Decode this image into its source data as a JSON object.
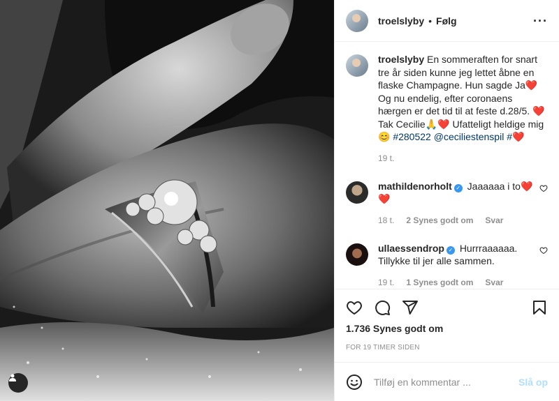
{
  "post": {
    "author": "troelslyby",
    "follow_label": "Følg",
    "dot": "•",
    "more_label": "···",
    "caption": {
      "user": "troelslyby",
      "text_1": "En sommeraften for snart tre år siden kunne jeg lettet åbne en flaske Champagne. Hun sagde Ja",
      "heart": "❤️",
      "text_2": "Og nu endelig, efter coronaens hærgen er det tid til at feste d.28/5. ",
      "text_3": "Tak Cecilie",
      "pray": "🙏",
      "text_4": " Ufatteligt heldige mig",
      "smile": "😊",
      "hashtag": "#280522",
      "mention": "@ceciliestenspil",
      "hash": "#",
      "age": "19 t."
    },
    "comments": [
      {
        "user": "mathildenorholt",
        "verified": "✓",
        "text": "Jaaaaaa i to",
        "hearts": "❤️",
        "hearts2": "❤️",
        "age": "18 t.",
        "likes": "2 Synes godt om",
        "reply": "Svar"
      },
      {
        "user": "ullaessendrop",
        "verified": "✓",
        "text": "Hurrraaaaaa. Tillykke til jer alle sammen.",
        "age": "19 t.",
        "likes": "1 Synes godt om",
        "reply": "Svar"
      }
    ],
    "like_count": "1.736 Synes godt om",
    "timestamp": "FOR 19 TIMER SIDEN",
    "comment_placeholder": "Tilføj en kommentar ...",
    "post_button": "Slå op"
  },
  "colors": {
    "link": "#00376b",
    "muted": "#8e8e8e",
    "verified": "#3897f0",
    "post_disabled": "#b2dffc"
  },
  "icons": [
    "more-icon",
    "heart-icon",
    "comment-icon",
    "share-icon",
    "bookmark-icon",
    "emoji-icon",
    "user-tag-icon",
    "verified-icon"
  ]
}
